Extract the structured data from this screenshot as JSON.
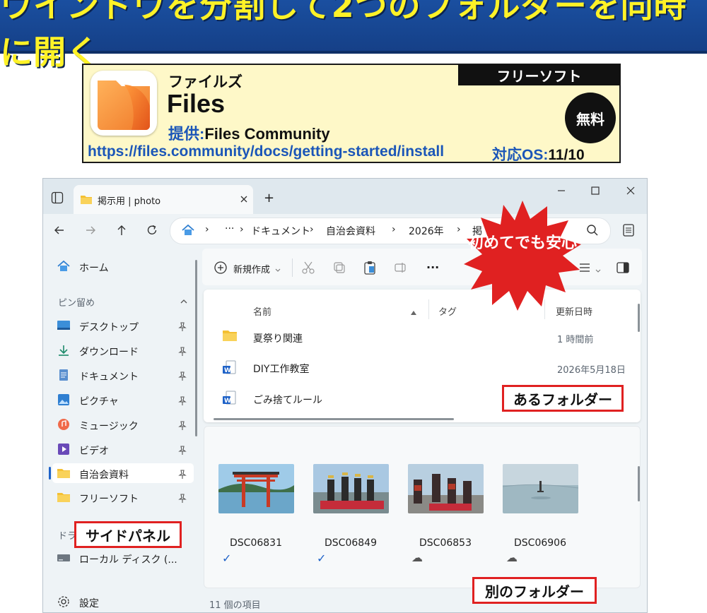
{
  "banner": {
    "title": "ウインドウを分割して2つのフォルダーを同時に開く"
  },
  "card": {
    "badge": "フリーソフト",
    "name_kana": "ファイルズ",
    "name": "Files",
    "provider_label": "提供:",
    "provider": "Files Community",
    "url": "https://files.community/docs/getting-started/install",
    "os_label": "対応OS:",
    "os": "11/10",
    "price": "無料"
  },
  "window": {
    "tab_title": "掲示用 | photo",
    "new_tab": "+",
    "breadcrumb": {
      "more": "···",
      "items": [
        "ドキュメント",
        "自治会資料",
        "2026年",
        "掲"
      ]
    },
    "toolbar": {
      "new_label": "新規作成"
    },
    "sidebar": {
      "home": "ホーム",
      "pinned_header": "ピン留め",
      "items": [
        {
          "label": "デスクトップ"
        },
        {
          "label": "ダウンロード"
        },
        {
          "label": "ドキュメント"
        },
        {
          "label": "ピクチャ"
        },
        {
          "label": "ミュージック"
        },
        {
          "label": "ビデオ"
        },
        {
          "label": "自治会資料"
        },
        {
          "label": "フリーソフト"
        }
      ],
      "drives_header": "ドラ",
      "drive": "ローカル ディスク (...",
      "settings": "設定"
    },
    "pane1": {
      "columns": {
        "name": "名前",
        "tag": "タグ",
        "modified": "更新日時"
      },
      "rows": [
        {
          "name": "夏祭り関連",
          "date": "1 時間前"
        },
        {
          "name": "DIY工作教室",
          "date": "2026年5月18日"
        },
        {
          "name": "ごみ捨てルール",
          "date": ""
        }
      ]
    },
    "pane2": {
      "files": [
        {
          "name": "DSC06831",
          "status": "✓"
        },
        {
          "name": "DSC06849",
          "status": "✓"
        },
        {
          "name": "DSC06853",
          "status": "☁"
        },
        {
          "name": "DSC06906",
          "status": "☁"
        }
      ]
    },
    "status": "11 個の項目"
  },
  "callouts": {
    "burst": "初めてでも安心",
    "folder1": "あるフォルダー",
    "sidepanel": "サイドパネル",
    "folder2": "別のフォルダー"
  },
  "colors": {
    "banner_bg": "#1a4fa0",
    "banner_text": "#fff227",
    "card_bg": "#fef8c8",
    "link_blue": "#1b56b8",
    "callout_red": "#e02121"
  }
}
